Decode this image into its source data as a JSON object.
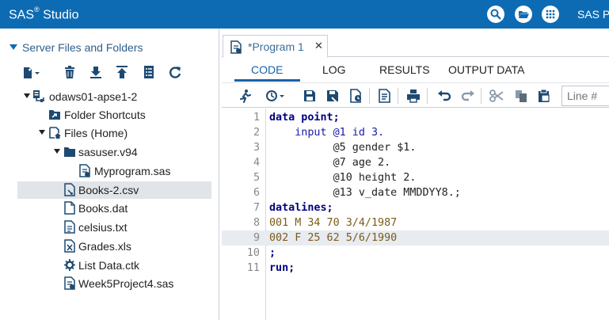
{
  "titlebar": {
    "app_name": "SAS",
    "app_reg": "®",
    "app_suffix": " Studio",
    "user_label": "SAS Pro",
    "icons": [
      "search-icon",
      "folder-open-icon",
      "apps-grid-icon"
    ]
  },
  "left_panel": {
    "title": "Server Files and Folders",
    "toolbar": [
      "new-icon",
      "delete-icon",
      "download-icon",
      "upload-icon",
      "properties-icon",
      "refresh-icon"
    ],
    "tree": [
      {
        "label": "odaws01-apse1-2",
        "icon": "server-icon",
        "indent": 0,
        "expanded": true
      },
      {
        "label": "Folder Shortcuts",
        "icon": "folder-shortcut-icon",
        "indent": 1,
        "expanded": false
      },
      {
        "label": "Files (Home)",
        "icon": "home-folder-icon",
        "indent": 1,
        "expanded": true
      },
      {
        "label": "sasuser.v94",
        "icon": "folder-icon",
        "indent": 2,
        "expanded": true
      },
      {
        "label": "Myprogram.sas",
        "icon": "sas-program-icon",
        "indent": 3
      },
      {
        "label": "Books-2.csv",
        "icon": "csv-file-icon",
        "indent": 2,
        "selected": true
      },
      {
        "label": "Books.dat",
        "icon": "file-icon",
        "indent": 2
      },
      {
        "label": "celsius.txt",
        "icon": "text-file-icon",
        "indent": 2
      },
      {
        "label": "Grades.xls",
        "icon": "excel-file-icon",
        "indent": 2
      },
      {
        "label": "List Data.ctk",
        "icon": "task-file-icon",
        "indent": 2
      },
      {
        "label": "Week5Project4.sas",
        "icon": "sas-program-icon",
        "indent": 2
      }
    ]
  },
  "editor": {
    "tab_label": "*Program 1",
    "tab_close": "✕",
    "subtabs": [
      "CODE",
      "LOG",
      "RESULTS",
      "OUTPUT DATA"
    ],
    "active_subtab": "CODE",
    "line_placeholder": "Line #",
    "toolbar_icons": [
      "run-icon",
      "history-icon",
      "save-icon",
      "save-as-icon",
      "save-log-icon",
      "code-snippet-icon",
      "print-icon",
      "undo-icon",
      "redo-icon",
      "cut-icon",
      "copy-icon",
      "paste-icon"
    ],
    "current_line": 9,
    "lines": [
      {
        "n": "1",
        "text": "data point;"
      },
      {
        "n": "2",
        "text": "    input @1 id 3."
      },
      {
        "n": "3",
        "text": "          @5 gender $1."
      },
      {
        "n": "4",
        "text": "          @7 age 2."
      },
      {
        "n": "5",
        "text": "          @10 height 2."
      },
      {
        "n": "6",
        "text": "          @13 v_date MMDDYY8.;"
      },
      {
        "n": "7",
        "text": "datalines;"
      },
      {
        "n": "8",
        "text": "001 M 34 70 3/4/1987"
      },
      {
        "n": "9",
        "text": "002 F 25 62 5/6/1990"
      },
      {
        "n": "10",
        "text": ";"
      },
      {
        "n": "11",
        "text": "run;"
      }
    ]
  },
  "colors": {
    "titlebar": "#0c6bb3",
    "accent": "#1a62a8",
    "keyword": "#00007f",
    "format": "#0a7f7a",
    "datalines": "#7a5c1a"
  }
}
